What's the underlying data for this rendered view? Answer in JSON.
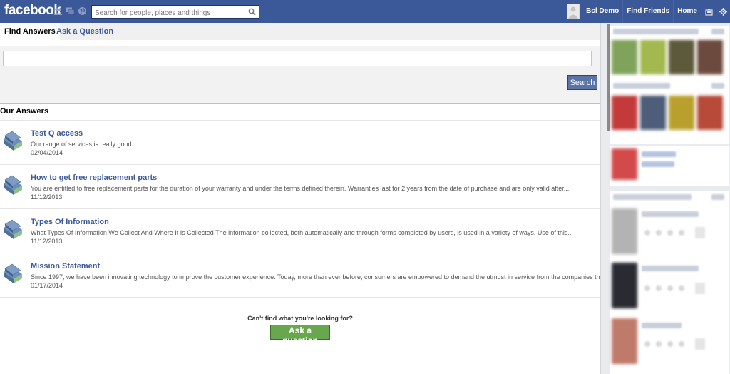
{
  "header": {
    "logo": "facebook",
    "search_placeholder": "Search for people, places and things",
    "user_name": "Bcl Demo",
    "find_friends": "Find Friends",
    "home": "Home"
  },
  "tabs": {
    "find_answers": "Find Answers",
    "ask_question": "Ask a Question"
  },
  "search": {
    "query": "",
    "button": "Search"
  },
  "answers": {
    "heading": "Our Answers",
    "items": [
      {
        "title": "Test Q access",
        "snippet": "Our range of services is really good.",
        "date": "02/04/2014"
      },
      {
        "title": "How to get free replacement parts",
        "snippet": "You are entitled to free replacement parts for the duration of your warranty and under the terms defined therein. Warranties last for 2 years from the date of purchase and are only valid after...",
        "date": "11/12/2013"
      },
      {
        "title": "Types Of Information",
        "snippet": "What Types Of Information We Collect And Where It Is Collected The information collected, both automatically and through forms completed by users, is used in a variety of ways. Use of this...",
        "date": "11/12/2013"
      },
      {
        "title": "Mission Statement",
        "snippet": "Since 1997, we have been innovating technology to improve the customer experience. Today, more than ever before, consumers are empowered to demand the utmost in service from the companies they choose...",
        "date": "01/17/2014"
      }
    ]
  },
  "cant_find": {
    "text": "Can't find what you're looking for?",
    "button": "Ask a question"
  },
  "colors": {
    "brand": "#3b5998",
    "search_button": "#5b74a8",
    "ask_button": "#69a74e"
  },
  "icons": [
    "friends-icon",
    "messages-icon",
    "globe-icon",
    "search-icon",
    "avatar",
    "privacy-icon",
    "gear-icon",
    "book-icon"
  ]
}
